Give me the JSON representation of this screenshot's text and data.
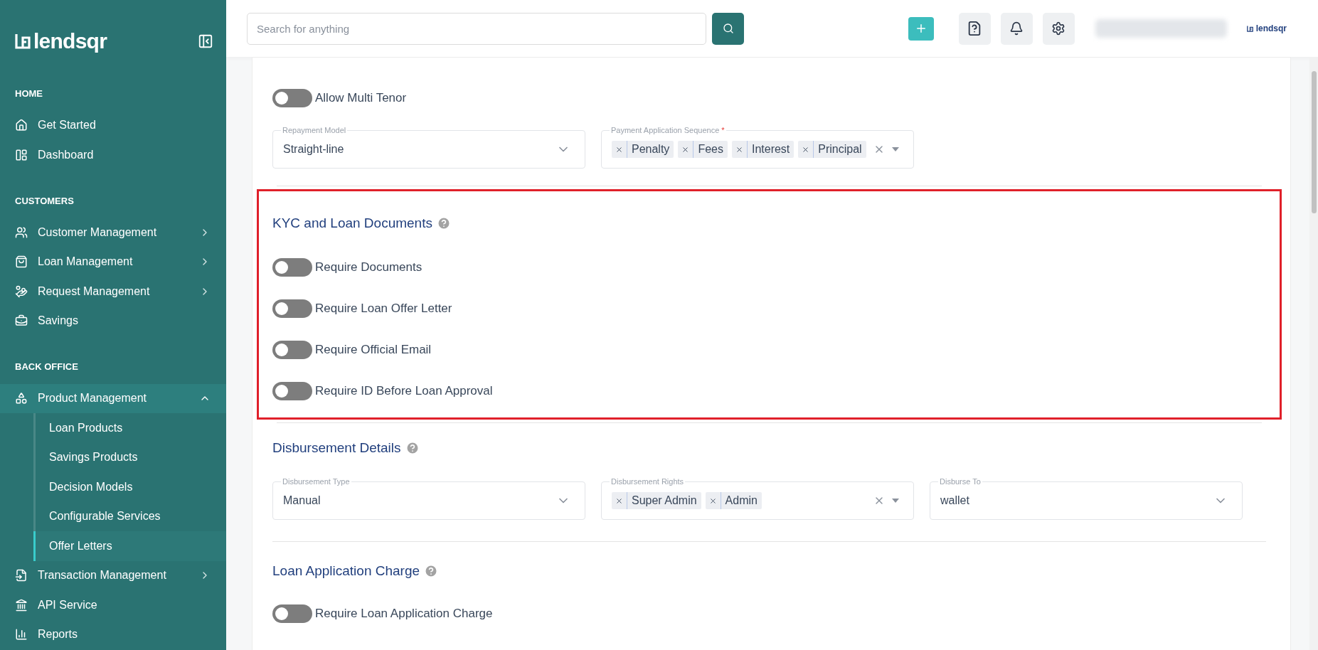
{
  "sidebar": {
    "logo": "lendsqr",
    "sections": [
      {
        "title": "HOME",
        "items": [
          {
            "label": "Get Started",
            "expandable": false
          },
          {
            "label": "Dashboard",
            "expandable": false
          }
        ]
      },
      {
        "title": "CUSTOMERS",
        "items": [
          {
            "label": "Customer Management",
            "expandable": true,
            "expanded": false
          },
          {
            "label": "Loan Management",
            "expandable": true,
            "expanded": false
          },
          {
            "label": "Request Management",
            "expandable": true,
            "expanded": false
          },
          {
            "label": "Savings",
            "expandable": false
          }
        ]
      },
      {
        "title": "BACK OFFICE",
        "items": [
          {
            "label": "Product Management",
            "expandable": true,
            "expanded": true,
            "children": [
              {
                "label": "Loan Products",
                "selected": false
              },
              {
                "label": "Savings Products",
                "selected": false
              },
              {
                "label": "Decision Models",
                "selected": false
              },
              {
                "label": "Configurable Services",
                "selected": false
              },
              {
                "label": "Offer Letters",
                "selected": true
              }
            ]
          },
          {
            "label": "Transaction Management",
            "expandable": true,
            "expanded": false
          },
          {
            "label": "API Service",
            "expandable": false
          },
          {
            "label": "Reports",
            "expandable": false
          }
        ]
      }
    ]
  },
  "topbar": {
    "search": {
      "placeholder": "Search for anything"
    },
    "brand": "lendsqr"
  },
  "sections": [
    {
      "highlighted": false,
      "toggles": [
        {
          "label": "Allow Multi Tenor",
          "on": false
        }
      ],
      "fields": [
        {
          "kind": "select",
          "label": "Repayment Model",
          "value": "Straight-line"
        },
        {
          "kind": "multi",
          "label": "Payment Application Sequence",
          "required_mark": "*",
          "tags": [
            "Penalty",
            "Fees",
            "Interest",
            "Principal"
          ]
        }
      ]
    },
    {
      "title": "KYC and Loan Documents",
      "highlighted": true,
      "toggles": [
        {
          "label": "Require Documents",
          "on": false
        },
        {
          "label": "Require Loan Offer Letter",
          "on": false
        },
        {
          "label": "Require Official Email",
          "on": false
        },
        {
          "label": "Require ID Before Loan Approval",
          "on": false
        }
      ]
    },
    {
      "title": "Disbursement Details",
      "highlighted": false,
      "fields": [
        {
          "kind": "select",
          "label": "Disbursement Type",
          "value": "Manual"
        },
        {
          "kind": "multi",
          "label": "Disbursement Rights",
          "tags": [
            "Super Admin",
            "Admin"
          ]
        },
        {
          "kind": "select",
          "label": "Disburse To",
          "value": "wallet"
        }
      ]
    },
    {
      "title": "Loan Application Charge",
      "highlighted": false,
      "toggles": [
        {
          "label": "Require Loan Application Charge",
          "on": false
        }
      ]
    }
  ]
}
